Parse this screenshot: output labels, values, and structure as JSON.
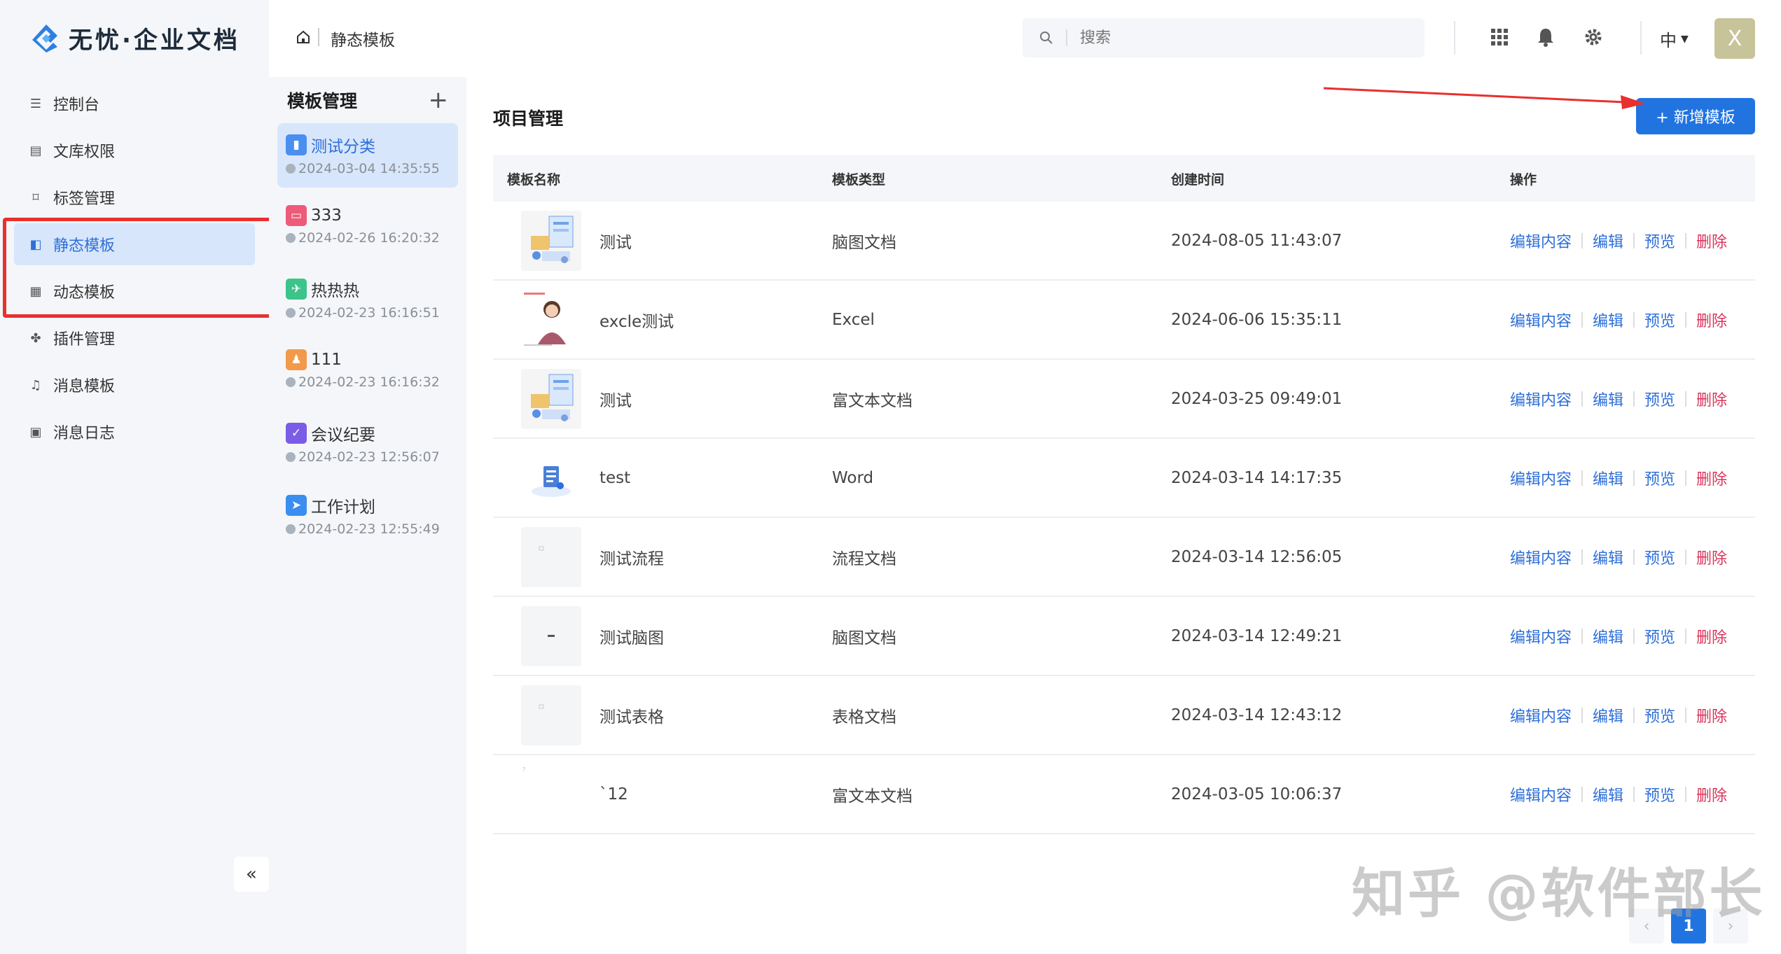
{
  "app": {
    "title": "无忧·企业文档"
  },
  "sidebar": {
    "items": [
      {
        "label": "控制台",
        "icon": "sliders-icon",
        "active": false
      },
      {
        "label": "文库权限",
        "icon": "library-icon",
        "active": false
      },
      {
        "label": "标签管理",
        "icon": "bookmark-icon",
        "active": false
      },
      {
        "label": "静态模板",
        "icon": "layout-icon",
        "active": true
      },
      {
        "label": "动态模板",
        "icon": "grid-icon",
        "active": false
      },
      {
        "label": "插件管理",
        "icon": "plugin-icon",
        "active": false
      },
      {
        "label": "消息模板",
        "icon": "bell-icon",
        "active": false
      },
      {
        "label": "消息日志",
        "icon": "log-icon",
        "active": false
      }
    ],
    "collapse_label": "«"
  },
  "header": {
    "breadcrumb": "静态模板",
    "search_placeholder": "搜索",
    "language": "中",
    "avatar_letter": "X"
  },
  "categories": {
    "title": "模板管理",
    "add_label": "+",
    "items": [
      {
        "name": "测试分类",
        "time": "2024-03-04 14:35:55",
        "color": "#4a8ef0",
        "active": true
      },
      {
        "name": "333",
        "time": "2024-02-26 16:20:32",
        "color": "#ee5a7a",
        "active": false
      },
      {
        "name": "热热热",
        "time": "2024-02-23 16:16:51",
        "color": "#3cc48a",
        "active": false
      },
      {
        "name": "111",
        "time": "2024-02-23 16:16:32",
        "color": "#f2994a",
        "active": false
      },
      {
        "name": "会议纪要",
        "time": "2024-02-23 12:56:07",
        "color": "#7b5ce6",
        "active": false
      },
      {
        "name": "工作计划",
        "time": "2024-02-23 12:55:49",
        "color": "#3a8ef0",
        "active": false
      }
    ]
  },
  "main": {
    "title": "项目管理",
    "add_button": "+ 新增模板",
    "columns": [
      "模板名称",
      "模板类型",
      "创建时间",
      "操作"
    ],
    "rows": [
      {
        "name": "测试",
        "type": "脑图文档",
        "time": "2024-08-05 11:43:07",
        "thumb": "illustration"
      },
      {
        "name": "excle测试",
        "type": "Excel",
        "time": "2024-06-06 15:35:11",
        "thumb": "person"
      },
      {
        "name": "测试",
        "type": "富文本文档",
        "time": "2024-03-25 09:49:01",
        "thumb": "illustration"
      },
      {
        "name": "test",
        "type": "Word",
        "time": "2024-03-14 14:17:35",
        "thumb": "doc"
      },
      {
        "name": "测试流程",
        "type": "流程文档",
        "time": "2024-03-14 12:56:05",
        "thumb": "blank"
      },
      {
        "name": "测试脑图",
        "type": "脑图文档",
        "time": "2024-03-14 12:49:21",
        "thumb": "dash"
      },
      {
        "name": "测试表格",
        "type": "表格文档",
        "time": "2024-03-14 12:43:12",
        "thumb": "blank"
      },
      {
        "name": "`12",
        "type": "富文本文档",
        "time": "2024-03-05 10:06:37",
        "thumb": "empty"
      }
    ],
    "ops": {
      "edit_content": "编辑内容",
      "edit": "编辑",
      "preview": "预览",
      "delete": "删除"
    }
  },
  "pagination": {
    "prev": "‹",
    "current": "1",
    "next": "›"
  },
  "watermark": "知乎 @软件部长",
  "colors": {
    "accent": "#2174e0",
    "delete": "#d9345a",
    "highlight_box": "#e8302f"
  }
}
